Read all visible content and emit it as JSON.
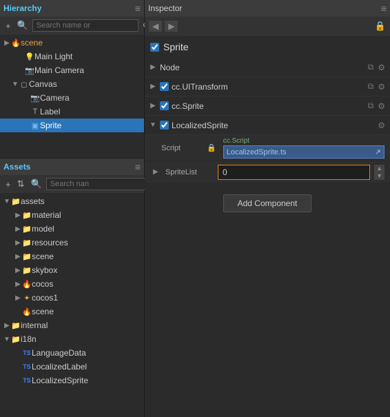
{
  "hierarchy": {
    "title": "Hierarchy",
    "search_placeholder": "Search name or",
    "tree": [
      {
        "id": "scene",
        "label": "scene",
        "level": 0,
        "type": "scene",
        "expanded": true
      },
      {
        "id": "main-light",
        "label": "Main Light",
        "level": 1,
        "type": "light"
      },
      {
        "id": "main-camera",
        "label": "Main Camera",
        "level": 1,
        "type": "camera"
      },
      {
        "id": "canvas",
        "label": "Canvas",
        "level": 1,
        "type": "canvas",
        "expanded": true
      },
      {
        "id": "camera",
        "label": "Camera",
        "level": 2,
        "type": "camera"
      },
      {
        "id": "label",
        "label": "Label",
        "level": 2,
        "type": "label"
      },
      {
        "id": "sprite",
        "label": "Sprite",
        "level": 2,
        "type": "sprite",
        "selected": true
      }
    ]
  },
  "assets": {
    "title": "Assets",
    "search_placeholder": "Search nan",
    "tree": [
      {
        "id": "assets",
        "label": "assets",
        "level": 0,
        "type": "folder",
        "expanded": true
      },
      {
        "id": "material",
        "label": "material",
        "level": 1,
        "type": "folder"
      },
      {
        "id": "model",
        "label": "model",
        "level": 1,
        "type": "folder"
      },
      {
        "id": "resources",
        "label": "resources",
        "level": 1,
        "type": "folder"
      },
      {
        "id": "scene",
        "label": "scene",
        "level": 1,
        "type": "folder"
      },
      {
        "id": "skybox",
        "label": "skybox",
        "level": 1,
        "type": "folder"
      },
      {
        "id": "cocos",
        "label": "cocos",
        "level": 1,
        "type": "cocos"
      },
      {
        "id": "cocos1",
        "label": "cocos1",
        "level": 1,
        "type": "cocos"
      },
      {
        "id": "scene2",
        "label": "scene",
        "level": 1,
        "type": "scene2"
      },
      {
        "id": "internal",
        "label": "internal",
        "level": 0,
        "type": "folder",
        "expanded": false
      },
      {
        "id": "i18n",
        "label": "i18n",
        "level": 0,
        "type": "folder",
        "expanded": true
      },
      {
        "id": "languagedata",
        "label": "LanguageData",
        "level": 1,
        "type": "ts"
      },
      {
        "id": "localizedlabel",
        "label": "LocalizedLabel",
        "level": 1,
        "type": "ts"
      },
      {
        "id": "localizedsprite",
        "label": "LocalizedSprite",
        "level": 1,
        "type": "ts"
      }
    ]
  },
  "inspector": {
    "title": "Inspector",
    "sprite_name": "Sprite",
    "components": [
      {
        "name": "Node",
        "has_checkbox": false,
        "checked": false
      },
      {
        "name": "cc.UITransform",
        "has_checkbox": true,
        "checked": true
      },
      {
        "name": "cc.Sprite",
        "has_checkbox": true,
        "checked": true
      },
      {
        "name": "LocalizedSprite",
        "has_checkbox": true,
        "checked": true
      }
    ],
    "script_hint": "cc.Script",
    "script_value": "LocalizedSprite.ts",
    "spritelist_label": "SpriteList",
    "spritelist_value": "0",
    "add_component_label": "Add Component"
  }
}
